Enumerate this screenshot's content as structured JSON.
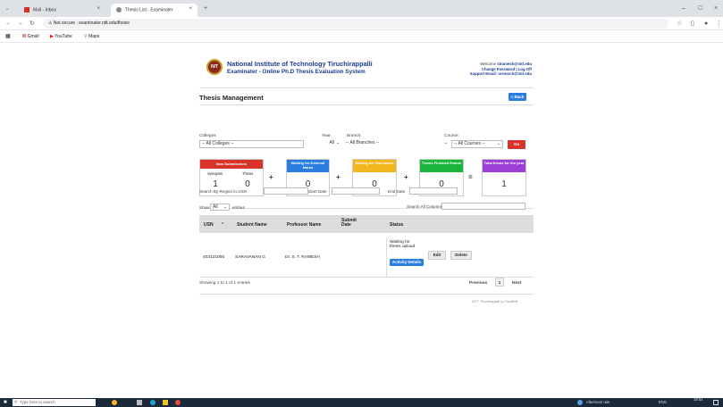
{
  "browser": {
    "tabs": [
      {
        "label": "Mail - Inbox",
        "active": false
      },
      {
        "label": "Thesis List - Examinater",
        "active": true
      }
    ],
    "new_tab_symbol": "+",
    "address": "examinater.nitt.edu/thesis",
    "security_label": "Not secure",
    "bookmarks": [
      "Gmail",
      "YouTube",
      "Maps"
    ]
  },
  "header": {
    "logo_text": "NIT",
    "institute": "National Institute of Technology Tiruchirappalli",
    "system": "Examinater - Online Ph.D Thesis Evaluation System",
    "welcome_prefix": "Welcome",
    "user_email": "stramesh@nitt.edu",
    "change_password": "Change Password",
    "separator": "|",
    "logoff": "Log Off",
    "support_label": "Support Email:",
    "support_email": "research@nitt.edu"
  },
  "page_title": "Thesis Management",
  "back_label": "< Back",
  "filters": {
    "colleges_label": "Colleges",
    "colleges_value": "-- All Colleges --",
    "year_label": "Year:",
    "year_value": "All",
    "branch_label": "Branch:",
    "branch_value": "-- All Branches --",
    "course_label": "Course:",
    "course_value": "-- All Courses --",
    "go_label": "Go"
  },
  "cards": {
    "new_submissions": {
      "title": "New Submissions",
      "sub1": "Synopsis",
      "sub2": "Thesis",
      "val1": "1",
      "val2": "0"
    },
    "waiting_external": {
      "title": "Waiting for External Marks",
      "value": "0"
    },
    "waiting_viva": {
      "title": "Waiting for Viva marks",
      "value": "0"
    },
    "thesis_finished": {
      "title": "Thesis Finished Exams",
      "value": "0"
    },
    "total": {
      "title": "Total thesis for the year",
      "value": "1"
    },
    "ops": [
      "+",
      "+",
      "+",
      "="
    ]
  },
  "search": {
    "region_label": "Search By Region in USN",
    "start_label": "Start Date",
    "end_label": "End Date",
    "show_label": "Show",
    "show_value": "All",
    "entries_label": "entries",
    "all_columns_label": "Search All Columns"
  },
  "table": {
    "headers": [
      "USN",
      "Student Name",
      "Professor Name",
      "Submit Date",
      "Status"
    ],
    "sort_arrow": "^",
    "rows": [
      {
        "usn": "403121005",
        "student": "SARAVANAN G",
        "professor": "Dr. S. T. RAMESH",
        "date": "",
        "status": "Waiting for thesis upload",
        "activity": "Activity Details",
        "edit": "Edit",
        "delete": "Delete"
      }
    ]
  },
  "pagination": {
    "info": "Showing 1 to 1 of 1 entries",
    "previous": "Previous",
    "page": "1",
    "next": "Next"
  },
  "footer": "NITT, Tiruchirappalli (c) TrustSoft",
  "taskbar": {
    "search_placeholder": "Type here to search",
    "weather": "Afternoon rain",
    "lang": "ENG",
    "time": "18:54"
  },
  "colors": {
    "brand_blue": "#1a3d8f",
    "btn_blue": "#2a7de1",
    "red": "#d9342b",
    "card_blue": "#2a7de1",
    "card_yellow": "#f2b71f",
    "card_green": "#1bb53b",
    "card_purple": "#9b3fd6"
  }
}
